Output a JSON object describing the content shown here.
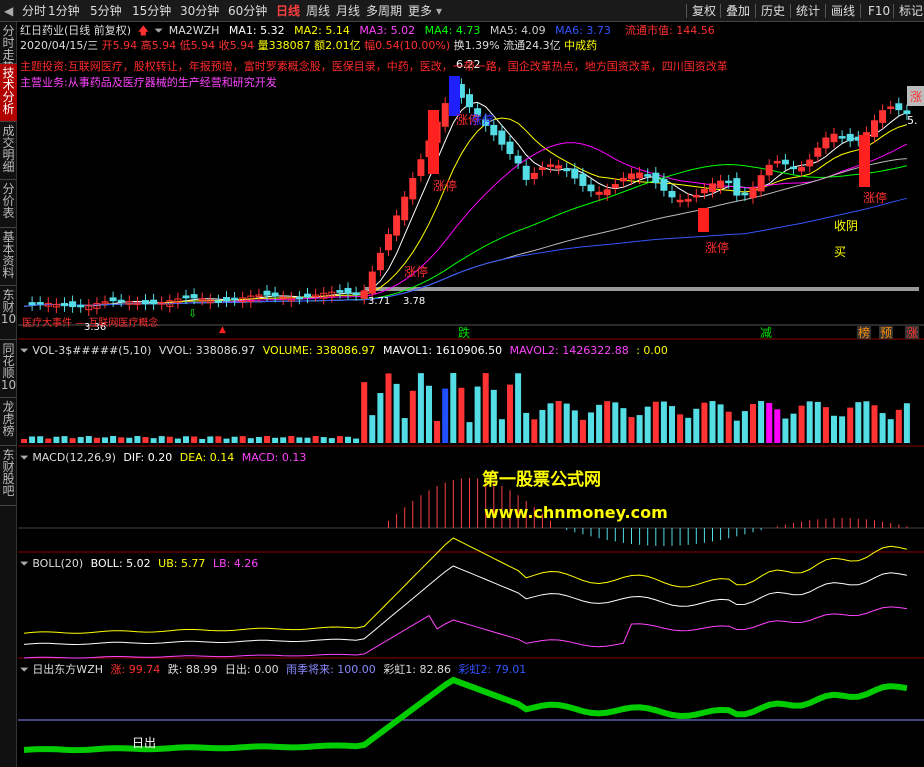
{
  "toolbar": {
    "periods": [
      "分时",
      "1分钟",
      "5分钟",
      "15分钟",
      "30分钟",
      "60分钟",
      "日线",
      "周线",
      "月线",
      "多周期",
      "更多"
    ],
    "active_period": "日线",
    "right_buttons": [
      "复权",
      "叠加",
      "历史",
      "统计",
      "画线",
      "F10",
      "标记"
    ]
  },
  "sidebar": {
    "tabs": [
      "分时走势",
      "技术分析",
      "成交明细",
      "分价表",
      "基本资料",
      "东财10",
      "同花顺10",
      "龙虎榜",
      "东财股吧"
    ],
    "active": "技术分析"
  },
  "colors": {
    "up": "#ff3333",
    "down": "#55dde6",
    "ma1": "#ffffff",
    "ma2": "#ffff00",
    "ma3": "#ff00ff",
    "ma4": "#00ff00",
    "ma5": "#bbbbbb",
    "ma6": "#3355ff",
    "label_red": "#ff3030",
    "label_blue": "#3030ff",
    "magenta": "#ff44ff"
  },
  "main": {
    "title": "红日药业(日线 前复权)",
    "indicator": "MA2WZH",
    "ma": [
      {
        "label": "MA1:",
        "value": "5.32"
      },
      {
        "label": "MA2:",
        "value": "5.14"
      },
      {
        "label": "MA3:",
        "value": "5.02"
      },
      {
        "label": "MA4:",
        "value": "4.73"
      },
      {
        "label": "MA5:",
        "value": "4.09"
      },
      {
        "label": "MA6:",
        "value": "3.73"
      }
    ],
    "market_cap": "流通市值: 144.56",
    "date": "2020/04/15/三",
    "open": "开5.94",
    "high": "高5.94",
    "low": "低5.94",
    "close": "收5.94",
    "volume": "量338087",
    "amount": "额2.01亿",
    "change": "幅0.54(10.00%)",
    "turnover": "换1.39%",
    "float": "流通24.3亿",
    "tag": "中成药",
    "themes": "主题投资:互联网医疗，股权转让，年报预增，富时罗素概念股，医保目录，中药，医改，一带一路，国企改革热点，地方国资改革，四川国资改革",
    "business": "主营业务:从事药品及医疗器械的生产经营和研究开发",
    "peak_price": "6.22",
    "low_price_left": "3.36",
    "support_a": "3.71",
    "support_b": "3.78",
    "right_edge_price": "5.",
    "bottom_banner": "医疗大事件 — 互联网医疗概念",
    "labels": [
      {
        "text": "涨停",
        "kind": "red"
      },
      {
        "text": "涨停",
        "kind": "red"
      },
      {
        "text": "涨停",
        "kind": "red"
      },
      {
        "text": "涨停",
        "kind": "blue"
      },
      {
        "text": "涨停",
        "kind": "red"
      },
      {
        "text": "涨停",
        "kind": "red"
      },
      {
        "text": "涨",
        "kind": "red"
      }
    ],
    "shouyin": "收阴买",
    "markers": [
      "跌",
      "减",
      "榜",
      "预",
      "涨"
    ]
  },
  "volume_panel": {
    "name": "VOL-3$#####(5,10)",
    "vvol": "VVOL: 338086.97",
    "volume": "VOLUME: 338086.97",
    "mavol1": "MAVOL1: 1610906.50",
    "mavol2": "MAVOL2: 1426322.88",
    "extra": ": 0.00"
  },
  "macd_panel": {
    "name": "MACD(12,26,9)",
    "dif": "DIF: 0.20",
    "dea": "DEA: 0.14",
    "macd": "MACD: 0.13"
  },
  "watermark": {
    "line1": "第一股票公式网",
    "line2": "www.chnmoney.com"
  },
  "boll_panel": {
    "name": "BOLL(20)",
    "boll": "BOLL: 5.02",
    "ub": "UB: 5.77",
    "lb": "LB: 4.26"
  },
  "sun_panel": {
    "name": "日出东方WZH",
    "zhang": "涨: 99.74",
    "die": "跌: 88.99",
    "richu": "日出: 0.00",
    "yuji": "雨季将来: 100.00",
    "caihong1": "彩虹1: 82.86",
    "caihong2": "彩虹2: 79.01",
    "richu_label": "日出"
  }
}
